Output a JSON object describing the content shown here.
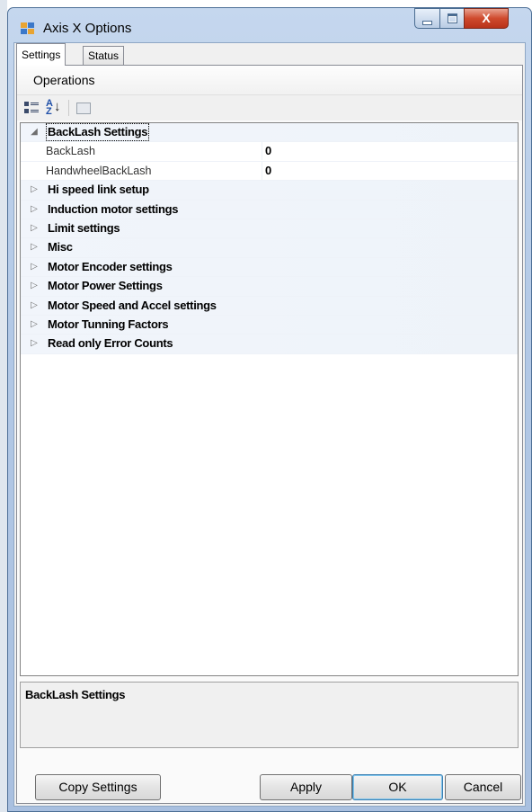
{
  "window": {
    "title": "Axis X Options",
    "close_glyph": "X"
  },
  "tabs": [
    {
      "label": "Settings"
    },
    {
      "label": "Status"
    }
  ],
  "operations_label": "Operations",
  "toolbar": {
    "sort_az_label": "A\nZ",
    "icons": [
      "categorized-icon",
      "sort-alphabetical-icon",
      "property-pages-icon"
    ]
  },
  "property_grid": {
    "rows": [
      {
        "kind": "category",
        "expanded": true,
        "label": "BackLash Settings"
      },
      {
        "kind": "property",
        "name": "BackLash",
        "value": "0"
      },
      {
        "kind": "property",
        "name": "HandwheelBackLash",
        "value": "0"
      },
      {
        "kind": "category",
        "expanded": false,
        "label": "Hi speed link setup"
      },
      {
        "kind": "category",
        "expanded": false,
        "label": "Induction motor settings"
      },
      {
        "kind": "category",
        "expanded": false,
        "label": "Limit settings"
      },
      {
        "kind": "category",
        "expanded": false,
        "label": "Misc"
      },
      {
        "kind": "category",
        "expanded": false,
        "label": "Motor Encoder settings"
      },
      {
        "kind": "category",
        "expanded": false,
        "label": "Motor Power Settings"
      },
      {
        "kind": "category",
        "expanded": false,
        "label": "Motor Speed and Accel settings"
      },
      {
        "kind": "category",
        "expanded": false,
        "label": "Motor Tunning Factors"
      },
      {
        "kind": "category",
        "expanded": false,
        "label": "Read only Error Counts"
      }
    ],
    "expanded_glyph": "◢",
    "collapsed_glyph": "▷"
  },
  "help_panel": {
    "title": "BackLash Settings"
  },
  "buttons": {
    "copy_settings": "Copy Settings",
    "apply": "Apply",
    "ok": "OK",
    "cancel": "Cancel"
  },
  "colors": {
    "title_bar": "#b3c9e6",
    "close_button": "#cf4a2d",
    "category_row": "#f1f5fb",
    "ok_focus": "#3c7fb1"
  }
}
